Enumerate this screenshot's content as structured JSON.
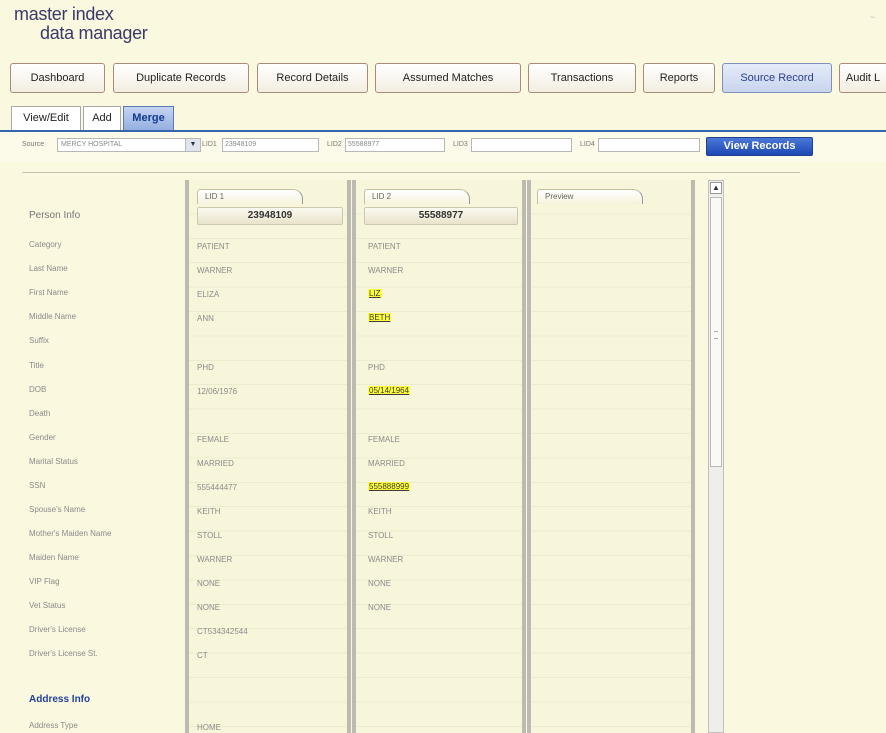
{
  "app": {
    "logo_line1": "master index",
    "logo_line2": "data manager",
    "corner": "~"
  },
  "nav": [
    {
      "label": "Dashboard"
    },
    {
      "label": "Duplicate Records"
    },
    {
      "label": "Record Details"
    },
    {
      "label": "Assumed Matches"
    },
    {
      "label": "Transactions"
    },
    {
      "label": "Reports"
    },
    {
      "label": "Source Record",
      "active": true
    },
    {
      "label": "Audit L"
    }
  ],
  "subtabs": [
    {
      "label": "View/Edit"
    },
    {
      "label": "Add"
    },
    {
      "label": "Merge",
      "active": true
    }
  ],
  "search": {
    "source_label": "Source",
    "source_value": "MERCY HOSPITAL",
    "lid1_label": "LID1",
    "lid1_value": "23948109",
    "lid2_label": "LID2",
    "lid2_value": "55588977",
    "lid3_label": "LID3",
    "lid3_value": "",
    "lid4_label": "LID4",
    "lid4_value": "",
    "view_button": "View Records"
  },
  "labels": {
    "person_info": "Person Info",
    "category": "Category",
    "last_name": "Last Name",
    "first_name": "First Name",
    "middle_name": "Middle Name",
    "suffix": "Suffix",
    "title": "Title",
    "dob": "DOB",
    "death": "Death",
    "gender": "Gender",
    "marital_status": "Marital Status",
    "ssn": "SSN",
    "spouses_name": "Spouse's Name",
    "mothers_maiden_name": "Mother's Maiden Name",
    "maiden_name": "Maiden Name",
    "vip_flag": "VIP Flag",
    "vet_status": "Vet Status",
    "drivers_license": "Driver's License",
    "drivers_license_st": "Driver's License St.",
    "address_info": "Address Info",
    "address_type": "Address Type"
  },
  "records": {
    "lid1": {
      "tab": "LID 1",
      "id": "23948109",
      "category": "PATIENT",
      "last_name": "WARNER",
      "first_name": "ELIZA",
      "middle_name": "ANN",
      "title": "PHD",
      "dob": "12/06/1976",
      "gender": "FEMALE",
      "marital_status": "MARRIED",
      "ssn": "555444477",
      "spouses_name": "KEITH",
      "mothers_maiden_name": "STOLL",
      "maiden_name": "WARNER",
      "vip_flag": "NONE",
      "vet_status": "NONE",
      "drivers_license": "CT534342544",
      "drivers_license_st": "CT",
      "address_type": "HOME"
    },
    "lid2": {
      "tab": "LID 2",
      "id": "55588977",
      "category": "PATIENT",
      "last_name": "WARNER",
      "first_name": "LIZ",
      "middle_name": "BETH",
      "title": "PHD",
      "dob": "05/14/1964",
      "gender": "FEMALE",
      "marital_status": "MARRIED",
      "ssn": "555888999",
      "spouses_name": "KEITH",
      "mothers_maiden_name": "STOLL",
      "maiden_name": "WARNER",
      "vip_flag": "NONE",
      "vet_status": "NONE"
    },
    "preview": {
      "tab": "Preview"
    }
  },
  "highlight_color": "#ffff3c"
}
